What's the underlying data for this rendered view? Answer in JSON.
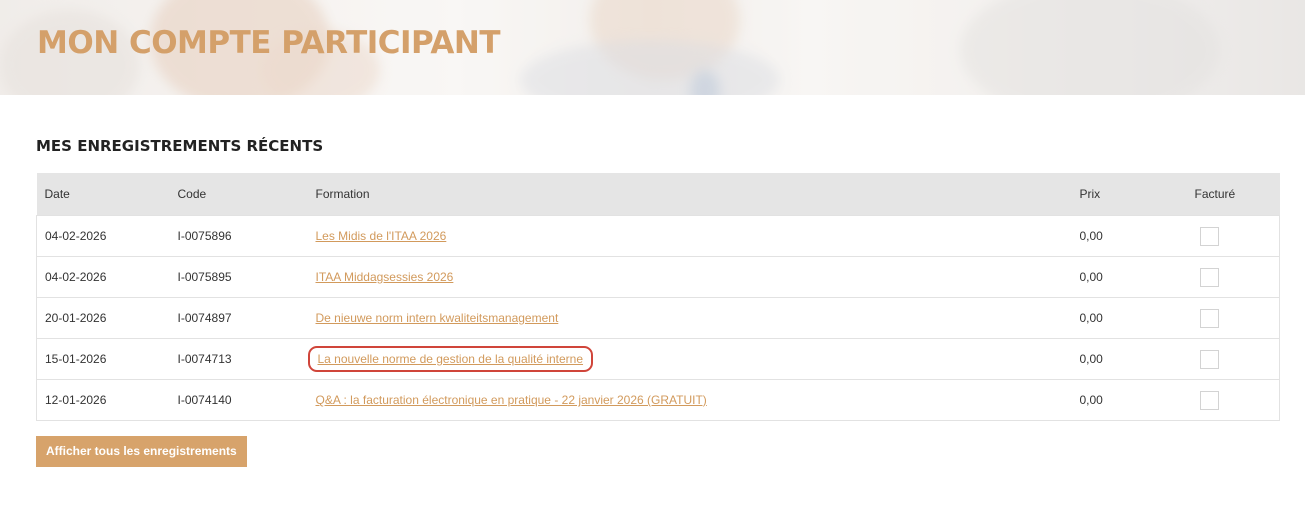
{
  "header": {
    "title": "MON COMPTE PARTICIPANT"
  },
  "registrations": {
    "section_title": "MES ENREGISTREMENTS RÉCENTS",
    "columns": {
      "date": "Date",
      "code": "Code",
      "formation": "Formation",
      "prix": "Prix",
      "facture": "Facturé"
    },
    "rows": [
      {
        "date": "04-02-2026",
        "code": "I-0075896",
        "formation": "Les Midis de l'ITAA 2026",
        "prix": "0,00",
        "facture": false
      },
      {
        "date": "04-02-2026",
        "code": "I-0075895",
        "formation": "ITAA Middagsessies 2026",
        "prix": "0,00",
        "facture": false
      },
      {
        "date": "20-01-2026",
        "code": "I-0074897",
        "formation": "De nieuwe norm intern kwaliteitsmanagement",
        "prix": "0,00",
        "facture": false
      },
      {
        "date": "15-01-2026",
        "code": "I-0074713",
        "formation": "La nouvelle norme de gestion de la qualité interne",
        "prix": "0,00",
        "facture": false
      },
      {
        "date": "12-01-2026",
        "code": "I-0074140",
        "formation": "Q&A : la facturation électronique en pratique - 22 janvier 2026 (GRATUIT)",
        "prix": "0,00",
        "facture": false
      }
    ],
    "show_all_label": "Afficher tous les enregistrements"
  },
  "colors": {
    "accent": "#d4a06a",
    "link": "#d29a5c",
    "button": "#d7a36b",
    "highlight_outline": "#d0453a",
    "table_header": "#e5e5e5"
  }
}
